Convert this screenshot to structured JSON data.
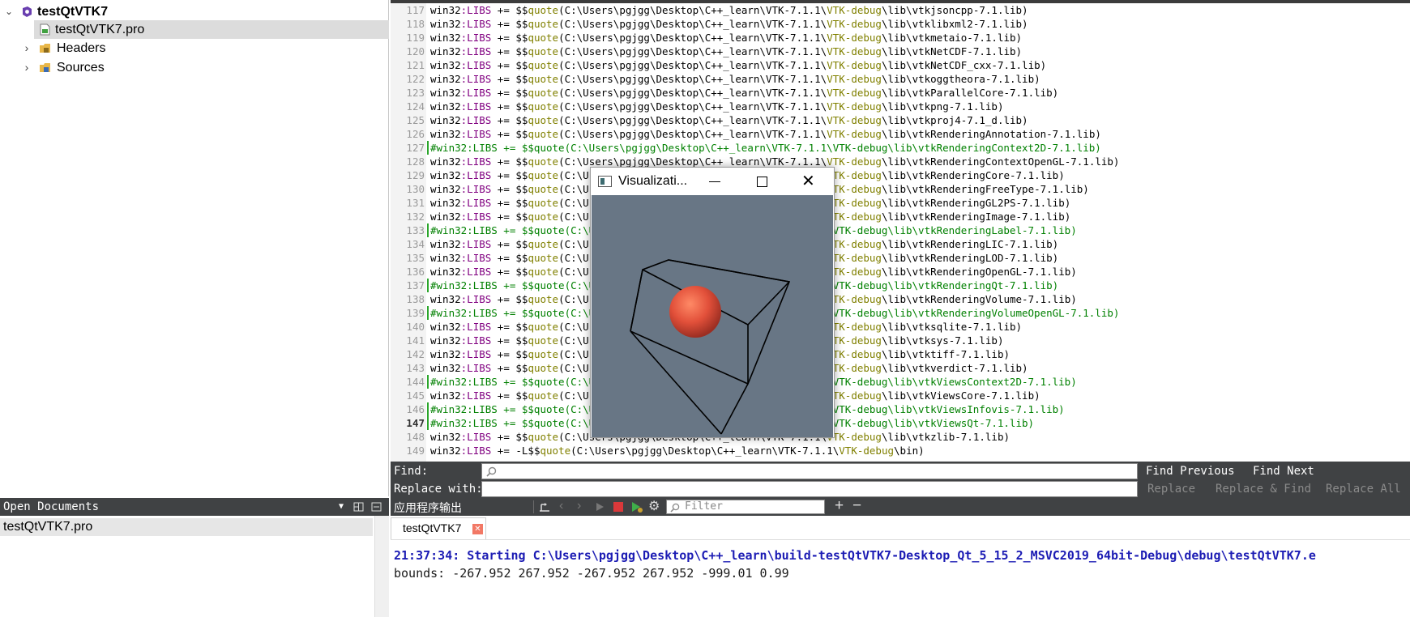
{
  "project": {
    "name": "testQtVTK7",
    "pro_file": "testQtVTK7.pro",
    "folders": [
      "Headers",
      "Sources"
    ]
  },
  "open_documents": {
    "title": "Open Documents",
    "items": [
      "testQtVTK7.pro"
    ]
  },
  "editor": {
    "lines": [
      {
        "num": "117",
        "comment": false,
        "lib": "vtkjsoncpp-7.1.lib"
      },
      {
        "num": "118",
        "comment": false,
        "lib": "vtklibxml2-7.1.lib"
      },
      {
        "num": "119",
        "comment": false,
        "lib": "vtkmetaio-7.1.lib"
      },
      {
        "num": "120",
        "comment": false,
        "lib": "vtkNetCDF-7.1.lib"
      },
      {
        "num": "121",
        "comment": false,
        "lib": "vtkNetCDF_cxx-7.1.lib"
      },
      {
        "num": "122",
        "comment": false,
        "lib": "vtkoggtheora-7.1.lib"
      },
      {
        "num": "123",
        "comment": false,
        "lib": "vtkParallelCore-7.1.lib"
      },
      {
        "num": "124",
        "comment": false,
        "lib": "vtkpng-7.1.lib"
      },
      {
        "num": "125",
        "comment": false,
        "lib": "vtkproj4-7.1_d.lib"
      },
      {
        "num": "126",
        "comment": false,
        "lib": "vtkRenderingAnnotation-7.1.lib"
      },
      {
        "num": "127",
        "comment": true,
        "lib": "vtkRenderingContext2D-7.1.lib"
      },
      {
        "num": "128",
        "comment": false,
        "lib": "vtkRenderingContextOpenGL-7.1.lib"
      },
      {
        "num": "129",
        "comment": false,
        "lib": "vtkRenderingCore-7.1.lib"
      },
      {
        "num": "130",
        "comment": false,
        "lib": "vtkRenderingFreeType-7.1.lib"
      },
      {
        "num": "131",
        "comment": false,
        "lib": "vtkRenderingGL2PS-7.1.lib"
      },
      {
        "num": "132",
        "comment": false,
        "lib": "vtkRenderingImage-7.1.lib"
      },
      {
        "num": "133",
        "comment": true,
        "lib": "vtkRenderingLabel-7.1.lib"
      },
      {
        "num": "134",
        "comment": false,
        "lib": "vtkRenderingLIC-7.1.lib"
      },
      {
        "num": "135",
        "comment": false,
        "lib": "vtkRenderingLOD-7.1.lib"
      },
      {
        "num": "136",
        "comment": false,
        "lib": "vtkRenderingOpenGL-7.1.lib"
      },
      {
        "num": "137",
        "comment": true,
        "lib": "vtkRenderingQt-7.1.lib"
      },
      {
        "num": "138",
        "comment": false,
        "lib": "vtkRenderingVolume-7.1.lib"
      },
      {
        "num": "139",
        "comment": true,
        "lib": "vtkRenderingVolumeOpenGL-7.1.lib"
      },
      {
        "num": "140",
        "comment": false,
        "lib": "vtksqlite-7.1.lib"
      },
      {
        "num": "141",
        "comment": false,
        "lib": "vtksys-7.1.lib"
      },
      {
        "num": "142",
        "comment": false,
        "lib": "vtktiff-7.1.lib"
      },
      {
        "num": "143",
        "comment": false,
        "lib": "vtkverdict-7.1.lib"
      },
      {
        "num": "144",
        "comment": true,
        "lib": "vtkViewsContext2D-7.1.lib"
      },
      {
        "num": "145",
        "comment": false,
        "lib": "vtkViewsCore-7.1.lib"
      },
      {
        "num": "146",
        "comment": true,
        "lib": "vtkViewsInfovis-7.1.lib"
      },
      {
        "num": "147",
        "comment": true,
        "lib": "vtkViewsQt-7.1.lib",
        "current": true
      },
      {
        "num": "148",
        "comment": false,
        "lib": "vtkzlib-7.1.lib"
      },
      {
        "num": "149",
        "comment": false,
        "special": "-L",
        "lib": "bin"
      }
    ],
    "path_prefix": "C:\\Users\\pgjgg\\Desktop\\C++_learn\\VTK-7.1.1\\",
    "path_debug": "VTK-debug",
    "path_lib": "\\lib\\",
    "tok_win32": "win32",
    "tok_libs": ":LIBS",
    "tok_op": " += ",
    "tok_dollar": "$$",
    "tok_quote": "quote",
    "tok_hash": "#"
  },
  "find_bar": {
    "find_label": "Find:",
    "replace_label": "Replace with:",
    "find_value": "",
    "replace_value": "",
    "find_previous": "Find Previous",
    "find_next": "Find Next",
    "replace": "Replace",
    "replace_and_find": "Replace & Find",
    "replace_all": "Replace All"
  },
  "output": {
    "pane_title": "应用程序输出",
    "filter_placeholder": "Filter",
    "tab_label": "testQtVTK7",
    "lines": [
      "21:37:34: Starting C:\\Users\\pgjgg\\Desktop\\C++_learn\\build-testQtVTK7-Desktop_Qt_5_15_2_MSVC2019_64bit-Debug\\debug\\testQtVTK7.e",
      "bounds: -267.952 267.952 -267.952 267.952 -999.01 0.99"
    ],
    "colors": {
      "start": "#1c1cb4",
      "normal": "#1a1a1a"
    }
  },
  "vtk_window": {
    "title": "Visualizati...",
    "background": "#687685",
    "sphere_color": "#e2503a"
  }
}
